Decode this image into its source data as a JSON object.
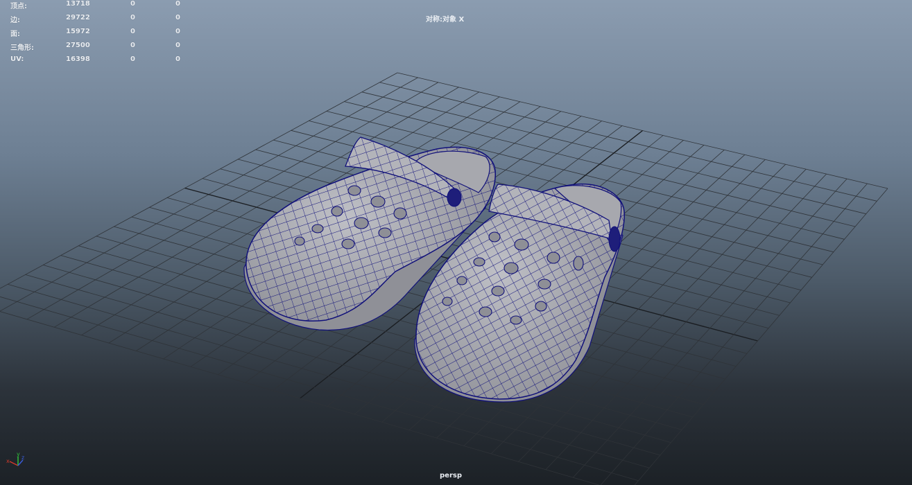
{
  "hud": {
    "rows": [
      {
        "label": "顶点:",
        "total": "13718",
        "selected": "0",
        "component": "0"
      },
      {
        "label": "边:",
        "total": "29722",
        "selected": "0",
        "component": "0"
      },
      {
        "label": "面:",
        "total": "15972",
        "selected": "0",
        "component": "0"
      },
      {
        "label": "三角形:",
        "total": "27500",
        "selected": "0",
        "component": "0"
      },
      {
        "label": "UV:",
        "total": "16398",
        "selected": "0",
        "component": "0"
      }
    ]
  },
  "symmetry_label": "对称:对象 X",
  "camera_name": "persp",
  "axis_labels": {
    "x": "x",
    "y": "y",
    "z": "z"
  },
  "colors": {
    "wire": "#10107a",
    "shoe_fill": "#a3a3a9",
    "grid_line": "#2f3338",
    "grid_axis": "#1a1d21",
    "axis_x": "#d23a2a",
    "axis_y": "#2fbf3a",
    "axis_z": "#3a5bd8"
  },
  "scene": {
    "objects": [
      "left-clog",
      "right-clog"
    ]
  }
}
